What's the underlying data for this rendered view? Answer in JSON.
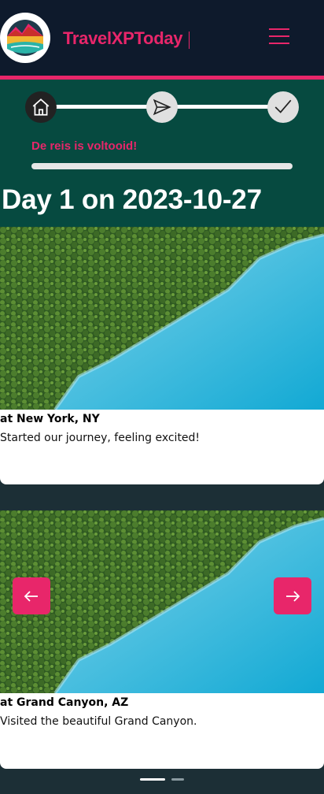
{
  "header": {
    "brand": "TravelXPToday",
    "logo_icon": "landscape-logo-icon",
    "menu_icon": "hamburger-menu-icon",
    "accent_color": "#e8266a"
  },
  "progress": {
    "steps": [
      {
        "icon": "home-icon",
        "state": "active"
      },
      {
        "icon": "send-icon",
        "state": "inactive"
      },
      {
        "icon": "check-icon",
        "state": "inactive"
      }
    ],
    "status_text": "De reis is voltooid!",
    "status_progress_fraction": 1.0
  },
  "day": {
    "title": "Day 1 on 2023-10-27"
  },
  "entries": [
    {
      "location": "at New York, NY",
      "text": "Started our journey, feeling excited!",
      "image": "aerial-forest-lake-photo"
    },
    {
      "location": "at Grand Canyon, AZ",
      "text": "Visited the beautiful Grand Canyon.",
      "image": "aerial-forest-lake-photo"
    }
  ],
  "carousel": {
    "prev_icon": "arrow-left-icon",
    "next_icon": "arrow-right-icon",
    "active_index": 0,
    "total": 2
  }
}
